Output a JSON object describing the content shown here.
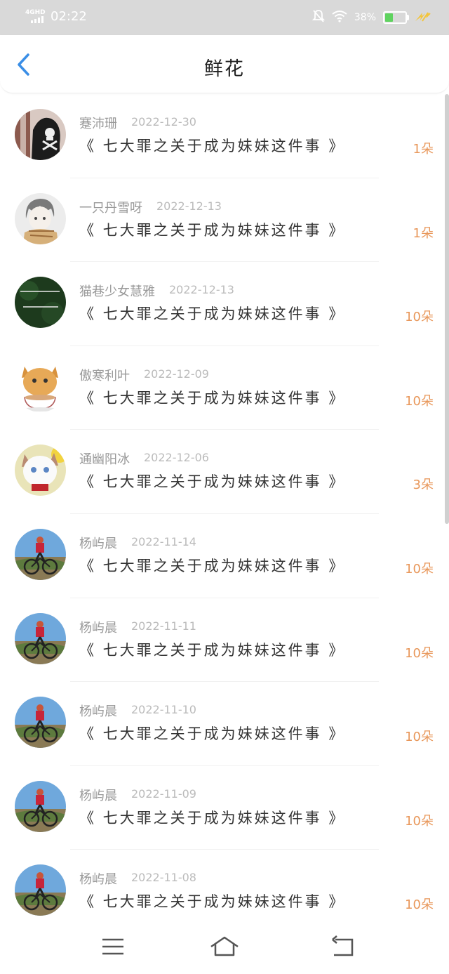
{
  "status_bar": {
    "network": "4GHD",
    "time": "02:22",
    "battery_percent": "38%",
    "battery_level": 0.38,
    "battery_color": "#5fd35f",
    "icons": [
      "mute-icon",
      "wifi-icon",
      "battery-icon",
      "charging-icon"
    ]
  },
  "header": {
    "title": "鲜花",
    "back_icon": "chevron-left-icon",
    "accent_color": "#3a8ee6"
  },
  "items": [
    {
      "user": "蹇沛珊",
      "date": "2022-12-30",
      "title": "《 七大罪之关于成为妹妹这件事 》",
      "count": "1朵",
      "avatar": "avatar-skull-hoodie"
    },
    {
      "user": "一只丹雪呀",
      "date": "2022-12-13",
      "title": "《 七大罪之关于成为妹妹这件事 》",
      "count": "1朵",
      "avatar": "avatar-anime-boy-scarf"
    },
    {
      "user": "猫巷少女慧雅",
      "date": "2022-12-13",
      "title": "《 七大罪之关于成为妹妹这件事 》",
      "count": "10朵",
      "avatar": "avatar-green-text"
    },
    {
      "user": "傲寒利叶",
      "date": "2022-12-09",
      "title": "《 七大罪之关于成为妹妹这件事 》",
      "count": "10朵",
      "avatar": "avatar-cat-teacup"
    },
    {
      "user": "通幽阳冰",
      "date": "2022-12-06",
      "title": "《 七大罪之关于成为妹妹这件事 》",
      "count": "3朵",
      "avatar": "avatar-white-cat"
    },
    {
      "user": "杨屿晨",
      "date": "2022-11-14",
      "title": "《 七大罪之关于成为妹妹这件事 》",
      "count": "10朵",
      "avatar": "avatar-cyclist"
    },
    {
      "user": "杨屿晨",
      "date": "2022-11-11",
      "title": "《 七大罪之关于成为妹妹这件事 》",
      "count": "10朵",
      "avatar": "avatar-cyclist"
    },
    {
      "user": "杨屿晨",
      "date": "2022-11-10",
      "title": "《 七大罪之关于成为妹妹这件事 》",
      "count": "10朵",
      "avatar": "avatar-cyclist"
    },
    {
      "user": "杨屿晨",
      "date": "2022-11-09",
      "title": "《 七大罪之关于成为妹妹这件事 》",
      "count": "10朵",
      "avatar": "avatar-cyclist"
    },
    {
      "user": "杨屿晨",
      "date": "2022-11-08",
      "title": "《 七大罪之关于成为妹妹这件事 》",
      "count": "10朵",
      "avatar": "avatar-cyclist"
    }
  ],
  "colors": {
    "count": "#e8975a",
    "user_name": "#999999",
    "date": "#bbbbbb",
    "title_text": "#333333"
  },
  "nav_bar": {
    "icons": [
      "menu-icon",
      "home-icon",
      "back-icon"
    ]
  }
}
